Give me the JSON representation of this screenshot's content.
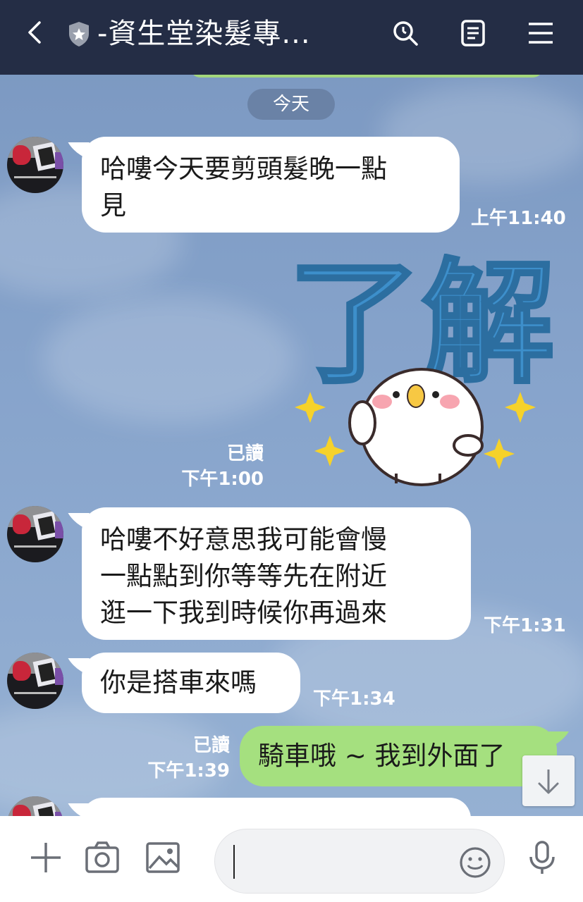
{
  "header": {
    "title": "-資生堂染髮專...",
    "icons": [
      "back-arrow-icon",
      "shield-icon",
      "search-icon",
      "notes-icon",
      "menu-icon"
    ]
  },
  "chat": {
    "date_label": "今天",
    "messages": [
      {
        "side": "in",
        "text_lines": [
          "哈嘍今天要剪頭髮晚一點",
          "見"
        ],
        "time": "上午11:40"
      },
      {
        "side": "out",
        "type": "sticker",
        "sticker_text": "了解",
        "read": "已讀",
        "time": "下午1:00"
      },
      {
        "side": "in",
        "text_lines": [
          "哈嘍不好意思我可能會慢",
          "一點點到你等等先在附近",
          "逛一下我到時候你再過來"
        ],
        "time": "下午1:31"
      },
      {
        "side": "in",
        "text_lines": [
          "你是搭車來嗎"
        ],
        "time": "下午1:34"
      },
      {
        "side": "out",
        "text_lines": [
          "騎車哦 ~ 我到外面了"
        ],
        "read": "已讀",
        "time": "下午1:39"
      }
    ]
  },
  "input": {
    "value": "",
    "placeholder": ""
  },
  "colors": {
    "header_bg": "#242d45",
    "outgoing_bubble": "#a5e07f",
    "incoming_bubble": "#ffffff",
    "chat_bg": "#7f9cc4"
  }
}
